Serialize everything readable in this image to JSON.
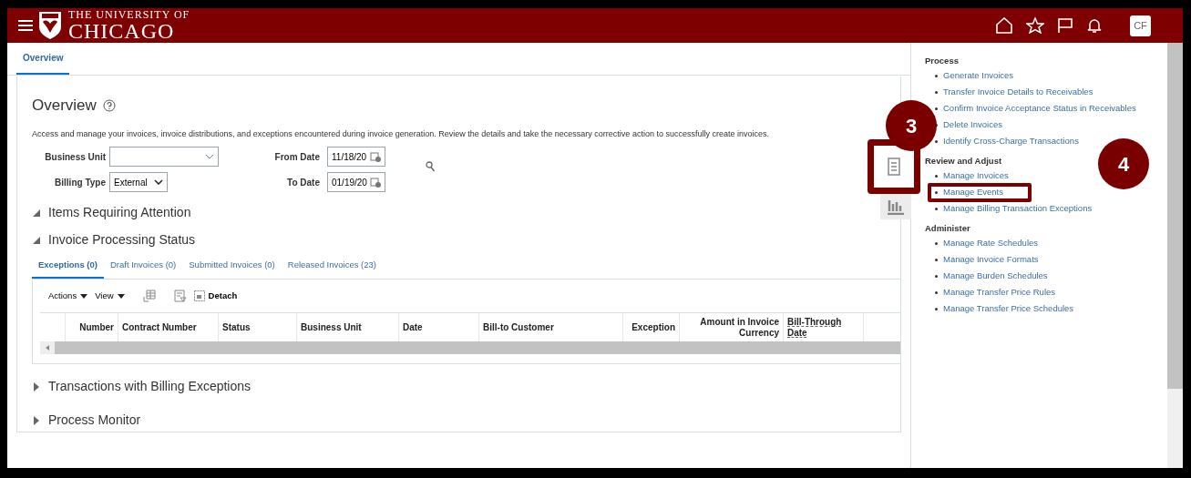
{
  "header": {
    "logo_line_1": "THE UNIVERSITY OF",
    "logo_line_2": "CHICAGO",
    "avatar": "CF"
  },
  "tabs": [
    {
      "label": "Overview",
      "selected": true
    }
  ],
  "page": {
    "title": "Overview",
    "description": "Access and manage your invoices, invoice distributions, and exceptions encountered during invoice generation. Review the details and take the necessary corrective action to successfully create invoices."
  },
  "filters": {
    "business_unit": {
      "label": "Business Unit"
    },
    "billing_type": {
      "label": "Billing Type",
      "value": "External"
    },
    "from_date": {
      "label": "From Date",
      "value": "11/18/20"
    },
    "to_date": {
      "label": "To Date",
      "value": "01/19/20"
    }
  },
  "sections": [
    {
      "title": "Items Requiring Attention",
      "expanded": true
    },
    {
      "title": "Invoice Processing Status",
      "expanded": true
    }
  ],
  "status_tabs": [
    {
      "label": "Exceptions (0)",
      "selected": true
    },
    {
      "label": "Draft Invoices (0)",
      "selected": false
    },
    {
      "label": "Submitted Invoices (0)",
      "selected": false
    },
    {
      "label": "Released Invoices (23)",
      "selected": false
    }
  ],
  "toolbar": {
    "actions": "Actions",
    "view": "View",
    "detach": "Detach"
  },
  "table": {
    "columns": [
      {
        "label": "Number",
        "underlined": false
      },
      {
        "label": "Contract Number",
        "underlined": false
      },
      {
        "label": "Status",
        "underlined": false
      },
      {
        "label": "Business Unit",
        "underlined": false
      },
      {
        "label": "Date",
        "underlined": false
      },
      {
        "label": "Bill-to Customer",
        "underlined": false
      },
      {
        "label": "Exception",
        "underlined": false
      },
      {
        "label": "Amount in Invoice Currency",
        "underlined": false
      },
      {
        "label": "Bill-Through Date",
        "underlined": true
      }
    ]
  },
  "collapsed_sections": [
    {
      "title": "Transactions with Billing Exceptions",
      "expanded": false
    },
    {
      "title": "Process Monitor",
      "expanded": false
    }
  ],
  "side_panel": [
    {
      "heading": "Process",
      "links": [
        "Generate Invoices",
        "Transfer Invoice Details to Receivables",
        "Confirm Invoice Acceptance Status in Receivables",
        "Delete Invoices",
        "Identify Cross-Charge Transactions"
      ]
    },
    {
      "heading": "Review and Adjust",
      "links": [
        "Manage Invoices",
        "Manage Events",
        "Manage Billing Transaction Exceptions"
      ]
    },
    {
      "heading": "Administer",
      "links": [
        "Manage Rate Schedules",
        "Manage Invoice Formats",
        "Manage Burden Schedules",
        "Manage Transfer Price Rules",
        "Manage Transfer Price Schedules"
      ]
    }
  ],
  "callouts": [
    "3",
    "4"
  ]
}
